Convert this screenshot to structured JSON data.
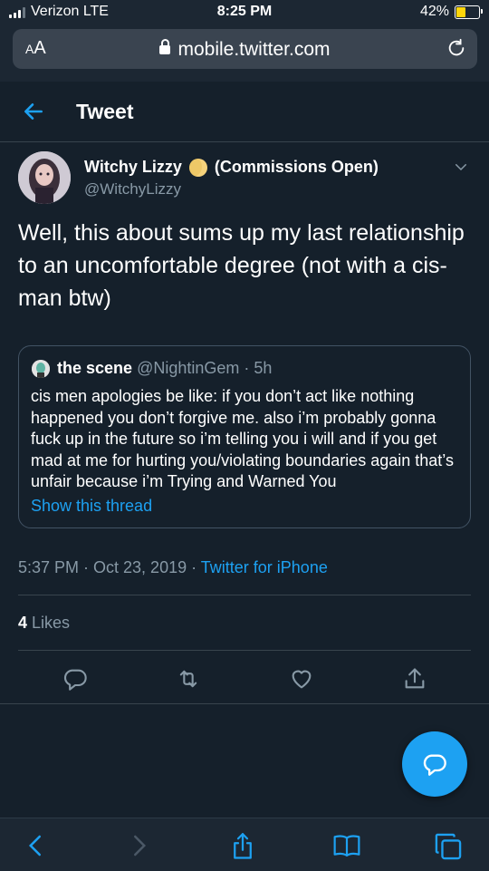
{
  "status_bar": {
    "carrier": "Verizon LTE",
    "time": "8:25 PM",
    "battery": "42%",
    "battery_level": 0.42
  },
  "browser": {
    "text_size_label": "AA",
    "url": "mobile.twitter.com"
  },
  "header": {
    "title": "Tweet"
  },
  "tweet": {
    "author_name": "Witchy Lizzy",
    "author_suffix": "(Commissions Open)",
    "handle": "@WitchyLizzy",
    "text": "Well, this about sums up my last relationship to an uncomfortable degree (not with a cis-man btw)",
    "quoted": {
      "author_name": "the scene",
      "handle_time": "@NightinGem · 5h",
      "text": "cis men apologies be like: if you don’t act like nothing happened you don’t forgive me. also i’m probably gonna fuck up in the future so i’m telling you i will and if you get mad at me for hurting you/violating boundaries again that’s unfair because i’m Trying and Warned You",
      "show_thread": "Show this thread"
    },
    "timestamp": "5:37 PM · Oct 23, 2019 · ",
    "source": "Twitter for iPhone",
    "likes_count": "4",
    "likes_label": " Likes"
  },
  "icons": {
    "back": "arrow-left-icon",
    "caret": "chevron-down-icon",
    "reply": "reply-icon",
    "retweet": "retweet-icon",
    "like": "heart-icon",
    "share": "share-icon",
    "compose": "compose-icon"
  },
  "colors": {
    "background": "#15202b",
    "accent": "#1da1f2",
    "muted": "#8899a6",
    "border": "#38444d"
  }
}
